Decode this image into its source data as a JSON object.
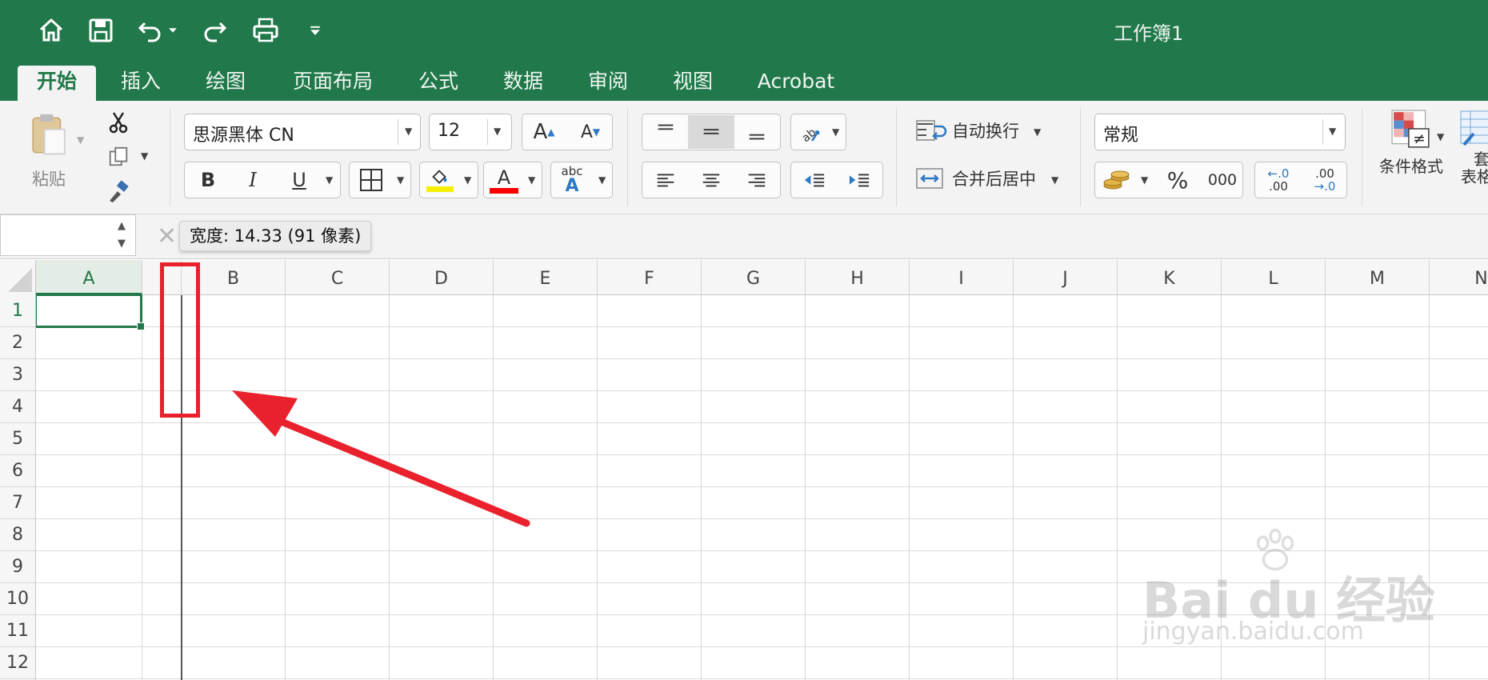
{
  "colors": {
    "accent": "#21784a",
    "annotation": "#e8212c",
    "ribbon_bg": "#f3f3f3"
  },
  "title_bar": {
    "document_title": "工作簿1",
    "quick_access": [
      "home-icon",
      "save-icon",
      "undo-icon",
      "redo-icon",
      "print-icon",
      "customize-icon"
    ]
  },
  "tabs": [
    {
      "label": "开始",
      "active": true
    },
    {
      "label": "插入",
      "active": false
    },
    {
      "label": "绘图",
      "active": false
    },
    {
      "label": "页面布局",
      "active": false
    },
    {
      "label": "公式",
      "active": false
    },
    {
      "label": "数据",
      "active": false
    },
    {
      "label": "审阅",
      "active": false
    },
    {
      "label": "视图",
      "active": false
    },
    {
      "label": "Acrobat",
      "active": false
    }
  ],
  "ribbon": {
    "clipboard": {
      "paste_label": "粘贴"
    },
    "font": {
      "font_name": "思源黑体 CN",
      "font_size": "12",
      "bold": "B",
      "italic": "I",
      "underline": "U",
      "grow_font": "A",
      "shrink_font": "A",
      "font_color_glyph": "A",
      "font_color": "#ff0000",
      "highlight_color": "#ffff00",
      "text_effects_glyph": "abc",
      "text_effects_letter": "A"
    },
    "alignment": {
      "wrap_text_label": "自动换行",
      "merge_center_label": "合并后居中"
    },
    "number": {
      "format": "常规",
      "percent": "%",
      "comma": "000",
      "increase_decimal_top": "←.0",
      "increase_decimal_bottom": ".00",
      "decrease_decimal_top": ".00",
      "decrease_decimal_bottom": "→.0"
    },
    "styles": {
      "conditional_format_label": "条件格式",
      "table_format_label_top": "套",
      "table_format_label_bottom": "表格"
    }
  },
  "formula_bar": {
    "name_box_value": "",
    "tooltip": "宽度: 14.33 (91 像素)"
  },
  "sheet": {
    "columns": [
      "A",
      "B",
      "C",
      "D",
      "E",
      "F",
      "G",
      "H",
      "I",
      "J",
      "K",
      "L",
      "M",
      "N"
    ],
    "rows": [
      "1",
      "2",
      "3",
      "4",
      "5",
      "6",
      "7",
      "8",
      "9",
      "10",
      "11",
      "12"
    ],
    "selected_cell": "A1"
  },
  "watermark": {
    "brand": "Bai du 经验",
    "url": "jingyan.baidu.com"
  }
}
